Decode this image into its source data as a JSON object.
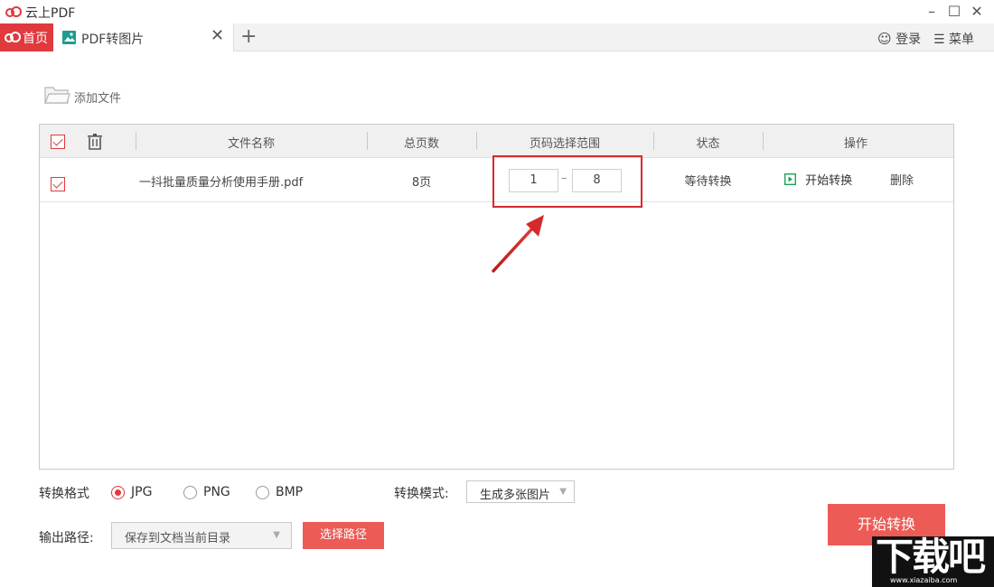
{
  "app": {
    "title": "云上PDF"
  },
  "tabs": {
    "home_label": "首页",
    "pdf_label": "PDF转图片",
    "close_glyph": "✕",
    "add_glyph": "+"
  },
  "header": {
    "login_label": "登录",
    "menu_label": "菜单"
  },
  "toolbar": {
    "add_file_label": "添加文件"
  },
  "table": {
    "columns": [
      "文件名称",
      "总页数",
      "页码选择范围",
      "状态",
      "操作"
    ],
    "rows": [
      {
        "file_name": "一抖批量质量分析使用手册.pdf",
        "total_pages": "8页",
        "range_start": "1",
        "range_sep": "–",
        "range_end": "8",
        "status": "等待转换",
        "action_start": "开始转换",
        "action_delete": "删除"
      }
    ]
  },
  "format": {
    "label": "转换格式",
    "options": [
      "JPG",
      "PNG",
      "BMP"
    ],
    "selected": "JPG"
  },
  "mode": {
    "label": "转换模式:",
    "value": "生成多张图片"
  },
  "output": {
    "label": "输出路径:",
    "value": "保存到文档当前目录",
    "choose_label": "选择路径"
  },
  "start_button_label": "开始转换",
  "watermark": {
    "text": "下载吧",
    "url": "www.xiazaiba.com"
  },
  "colors": {
    "accent": "#e0393e",
    "button": "#ec5b56",
    "play": "#1aa35a"
  }
}
